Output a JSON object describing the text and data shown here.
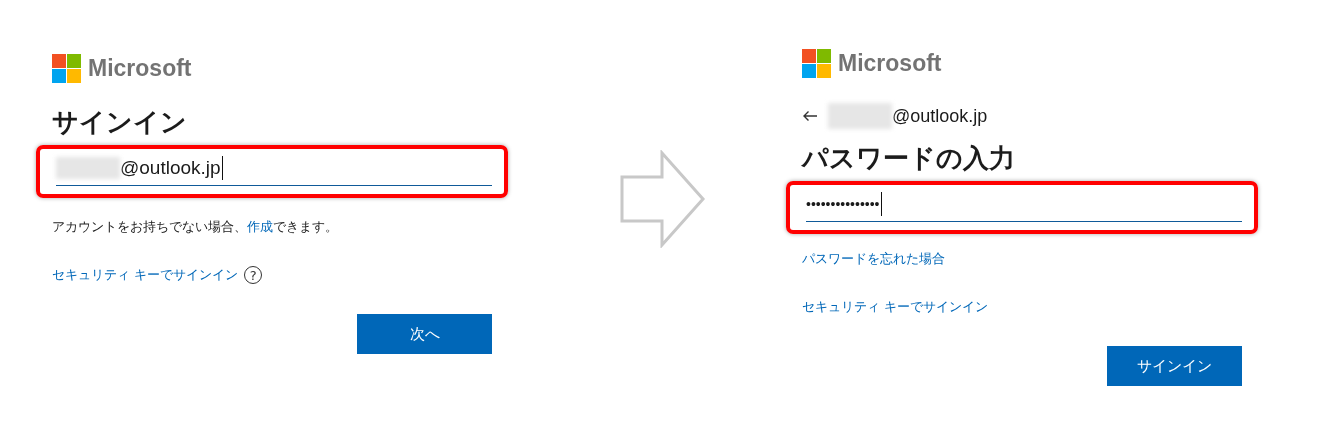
{
  "sign_in_step": {
    "logo_text": "Microsoft",
    "title": "サインイン",
    "field": {
      "value": "@outlook.jp",
      "redacted": true,
      "highlighted": true
    },
    "no_account_text": {
      "prefix": "アカウントをお持ちでない場合、",
      "link": "作成",
      "suffix": "できます。"
    },
    "security_key_link": "セキュリティ キーでサインイン",
    "help_mark": "?",
    "button": "次へ"
  },
  "password_step": {
    "logo_text": "Microsoft",
    "identity": {
      "value": "@outlook.jp",
      "redacted": true
    },
    "title": "パスワードの入力",
    "field": {
      "value": "•••••••••••••••",
      "highlighted": true
    },
    "links": [
      "パスワードを忘れた場合",
      "セキュリティ キーでサインイン"
    ],
    "button": "サインイン"
  }
}
